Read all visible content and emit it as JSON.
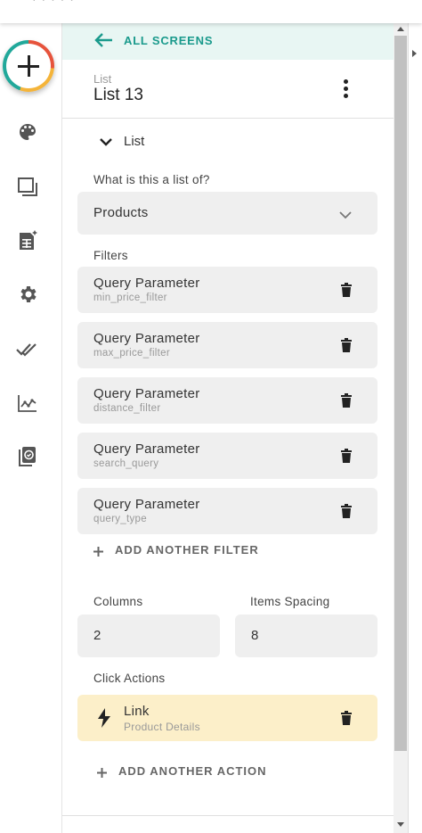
{
  "topbar": {
    "cut_text": "· · · · ·"
  },
  "rail": {
    "items": [
      {
        "name": "add-button",
        "icon": "plus-icon"
      },
      {
        "name": "branding",
        "icon": "palette-icon"
      },
      {
        "name": "screens",
        "icon": "screens-icon"
      },
      {
        "name": "database",
        "icon": "database-sparkle-icon"
      },
      {
        "name": "settings",
        "icon": "gear-icon"
      },
      {
        "name": "checks",
        "icon": "double-check-icon"
      },
      {
        "name": "analytics",
        "icon": "analytics-chart-icon"
      },
      {
        "name": "publish",
        "icon": "publish-copy-icon"
      }
    ]
  },
  "panel": {
    "back_label": "ALL SCREENS",
    "component_type": "List",
    "component_name": "List 13",
    "section_label": "List",
    "list_of_label": "What is this a list of?",
    "list_of_value": "Products",
    "filters_label": "Filters",
    "filters": [
      {
        "title": "Query Parameter",
        "sub": "min_price_filter"
      },
      {
        "title": "Query Parameter",
        "sub": "max_price_filter"
      },
      {
        "title": "Query Parameter",
        "sub": "distance_filter"
      },
      {
        "title": "Query Parameter",
        "sub": "search_query"
      },
      {
        "title": "Query Parameter",
        "sub": "query_type"
      }
    ],
    "add_filter_label": "ADD ANOTHER FILTER",
    "columns_label": "Columns",
    "columns_value": "2",
    "spacing_label": "Items Spacing",
    "spacing_value": "8",
    "click_actions_label": "Click Actions",
    "action": {
      "title": "Link",
      "sub": "Product Details"
    },
    "add_action_label": "ADD ANOTHER ACTION"
  },
  "colors": {
    "accent": "#1a9a8c",
    "header_bg": "#e8f6f3",
    "field_bg": "#efefef",
    "action_bg": "#fcefc9"
  }
}
